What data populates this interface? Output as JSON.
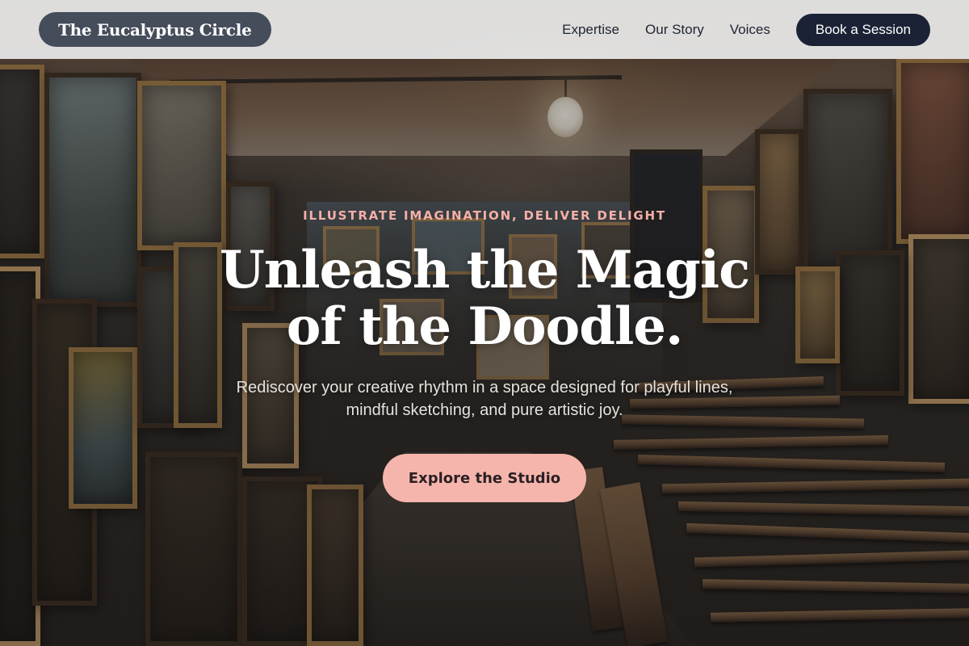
{
  "brand": {
    "name": "The Eucalyptus Circle"
  },
  "nav": {
    "links": [
      "Expertise",
      "Our Story",
      "Voices"
    ],
    "cta_label": "Book a Session"
  },
  "hero": {
    "eyebrow": "ILLUSTRATE IMAGINATION, DELIVER DELIGHT",
    "headline_line1": "Unleash the Magic",
    "headline_line2": "of the Doodle.",
    "subtext": "Rediscover your creative rhythm in a space designed for playful lines, mindful sketching, and pure artistic joy.",
    "cta_label": "Explore the Studio"
  },
  "colors": {
    "nav_background": "#e8e8e8",
    "brand_pill": "#454c5a",
    "nav_cta": "#1b2235",
    "accent_pink": "#f6b5ac",
    "eyebrow_text": "#f5b0a6"
  }
}
